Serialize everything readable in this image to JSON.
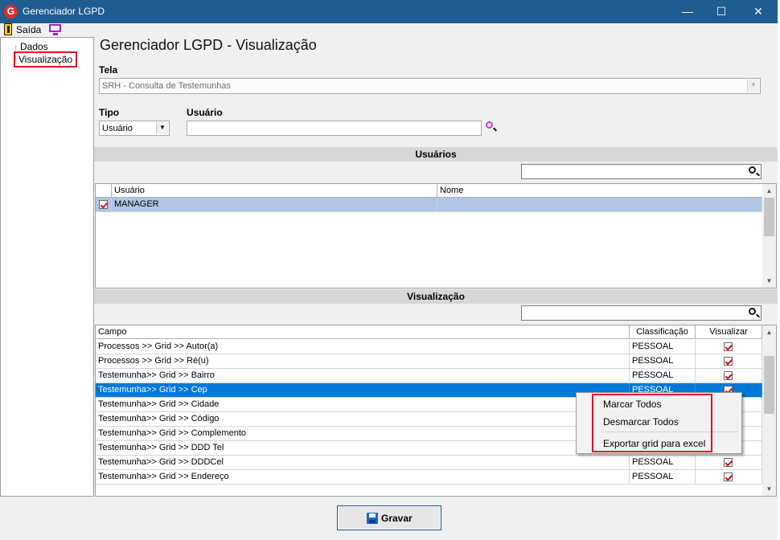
{
  "window": {
    "title": "Gerenciador LGPD",
    "icon": "app-logo-icon",
    "controls": [
      "minimize",
      "maximize",
      "close"
    ]
  },
  "menu": {
    "items": [
      "Saída"
    ]
  },
  "sidebar": {
    "items": [
      {
        "label": "Dados"
      },
      {
        "label": "Visualização",
        "selected": true
      }
    ]
  },
  "page": {
    "title": "Gerenciador LGPD - Visualização"
  },
  "form": {
    "tela_label": "Tela",
    "tela_value": "SRH - Consulta de Testemunhas",
    "tipo_label": "Tipo",
    "tipo_value": "Usuário",
    "usuario_label": "Usuário",
    "usuario_value": ""
  },
  "users_section": {
    "title": "Usuários",
    "search_value": "",
    "columns": [
      "Usuário",
      "Nome"
    ],
    "rows": [
      {
        "checked": true,
        "usuario": "MANAGER",
        "nome": ""
      }
    ]
  },
  "viz_section": {
    "title": "Visualização",
    "search_value": "",
    "columns": [
      "Campo",
      "Classificação",
      "Visualizar"
    ],
    "rows": [
      {
        "campo": "Processos >> Grid >> Autor(a)",
        "classificacao": "PESSOAL",
        "visualizar": true
      },
      {
        "campo": "Processos >> Grid >> Ré(u)",
        "classificacao": "PESSOAL",
        "visualizar": true
      },
      {
        "campo": "Testemunha>> Grid >> Bairro",
        "classificacao": "PESSOAL",
        "visualizar": true
      },
      {
        "campo": "Testemunha>> Grid >> Cep",
        "classificacao": "PESSOAL",
        "visualizar": true,
        "selected": true
      },
      {
        "campo": "Testemunha>> Grid >> Cidade",
        "classificacao": "",
        "visualizar": true
      },
      {
        "campo": "Testemunha>> Grid >> Código",
        "classificacao": "",
        "visualizar": true
      },
      {
        "campo": "Testemunha>> Grid >> Complemento",
        "classificacao": "",
        "visualizar": true
      },
      {
        "campo": "Testemunha>> Grid >> DDD Tel",
        "classificacao": "",
        "visualizar": true
      },
      {
        "campo": "Testemunha>> Grid >> DDDCel",
        "classificacao": "PESSOAL",
        "visualizar": true
      },
      {
        "campo": "Testemunha>> Grid >> Endereço",
        "classificacao": "PESSOAL",
        "visualizar": true
      }
    ]
  },
  "context_menu": {
    "items": [
      "Marcar Todos",
      "Desmarcar Todos",
      "Exportar grid para excel"
    ]
  },
  "footer": {
    "save_label": "Gravar"
  },
  "colors": {
    "titlebar": "#1f5c8f",
    "selection": "#0078d7",
    "highlight_box": "#e01020",
    "checkmark": "#d0101a"
  }
}
